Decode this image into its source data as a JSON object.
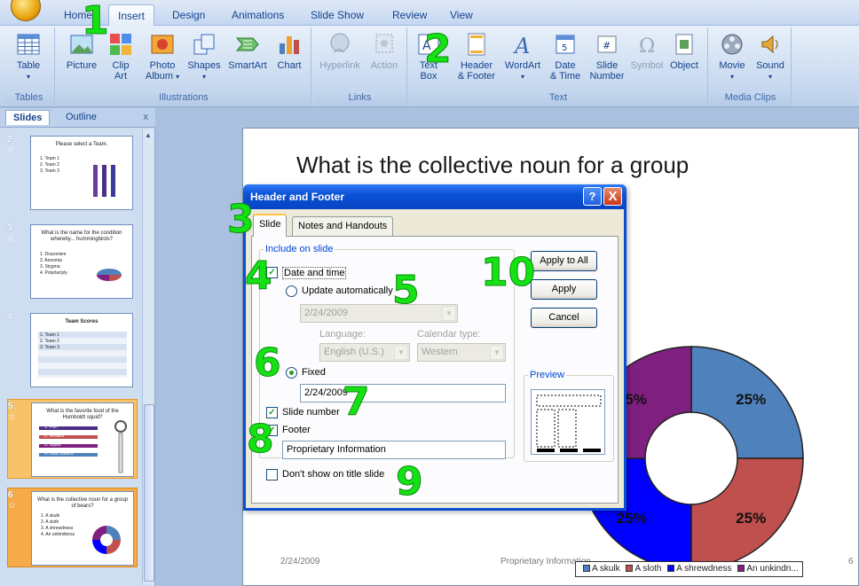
{
  "ribbon": {
    "tabs": [
      "Home",
      "Insert",
      "Design",
      "Animations",
      "Slide Show",
      "Review",
      "View"
    ],
    "active_tab": "Insert",
    "groups": {
      "tables": {
        "label": "Tables",
        "table": "Table"
      },
      "illustrations": {
        "label": "Illustrations",
        "picture": "Picture",
        "clip_art": [
          "Clip",
          "Art"
        ],
        "photo_album": [
          "Photo",
          "Album"
        ],
        "shapes": "Shapes",
        "smartart": "SmartArt",
        "chart": "Chart"
      },
      "links": {
        "label": "Links",
        "hyperlink": "Hyperlink",
        "action": "Action"
      },
      "text": {
        "label": "Text",
        "text_box": [
          "Text",
          "Box"
        ],
        "header_footer": [
          "Header",
          "& Footer"
        ],
        "wordart": "WordArt",
        "date_time": [
          "Date",
          "& Time"
        ],
        "slide_number": [
          "Slide",
          "Number"
        ],
        "symbol": "Symbol",
        "object": "Object"
      },
      "media": {
        "label": "Media Clips",
        "movie": "Movie",
        "sound": "Sound"
      }
    }
  },
  "left_pane": {
    "tabs": [
      "Slides",
      "Outline"
    ],
    "close": "x",
    "thumbnails": [
      {
        "num": "2",
        "title": "Please select a Team.",
        "lines": [
          "1. Team 1",
          "2. Team 2",
          "3. Team 3"
        ]
      },
      {
        "num": "3",
        "title": "What is the name for the condition whereby... hummingbirds?",
        "lines": [
          "1. Draconism",
          "2. Anosmia",
          "3. Stygma",
          "4. Polydactyly"
        ]
      },
      {
        "num": "4",
        "title": "Team Scores",
        "lines": [
          "1. Team 1",
          "2. Team 2",
          "3. Team 3"
        ]
      },
      {
        "num": "5",
        "title": "What is the favorite food of the Humboldt squid?",
        "lines": [
          "1. Fish",
          "2. Whales",
          "3. Squid",
          "4. Leaf Cutters"
        ]
      },
      {
        "num": "6",
        "title": "What is the collective noun for a group of bears?",
        "lines": [
          "1. A skulk",
          "2. A sloth",
          "3. A shrewdness",
          "4. An unkindness"
        ]
      }
    ]
  },
  "slide": {
    "title": "What is the collective noun for a group",
    "date": "2/24/2009",
    "footer": "Proprietary Information",
    "slide_number": "6",
    "legend": [
      "A skulk",
      "A sloth",
      "A shrewdness",
      "An unkindn..."
    ]
  },
  "chart_data": {
    "type": "pie",
    "categories": [
      "A skulk",
      "A sloth",
      "A shrewdness",
      "An unkindn..."
    ],
    "values": [
      25,
      25,
      25,
      25
    ],
    "labels": [
      "25%",
      "25%",
      "25%",
      "25%"
    ],
    "colors": [
      "#4f81bd",
      "#c0504d",
      "#0000ff",
      "#7f1f7f"
    ],
    "title": "",
    "legend": "bottom"
  },
  "dialog": {
    "title": "Header and Footer",
    "help": "?",
    "close": "X",
    "tabs": [
      "Slide",
      "Notes and Handouts"
    ],
    "include_legend": "Include on slide",
    "date_time": "Date and time",
    "update_auto": "Update automatically",
    "auto_date": "2/24/2009",
    "language_label": "Language:",
    "language": "English (U.S.)",
    "calendar_label": "Calendar type:",
    "calendar": "Western",
    "fixed": "Fixed",
    "fixed_date": "2/24/2009",
    "slide_number": "Slide number",
    "footer": "Footer",
    "footer_text": "Proprietary Information",
    "dont_show": "Don't show on title slide",
    "apply_all": "Apply to All",
    "apply": "Apply",
    "cancel": "Cancel",
    "preview": "Preview"
  },
  "steps": [
    "1",
    "2",
    "3",
    "4",
    "5",
    "6",
    "7",
    "8",
    "9",
    "10"
  ]
}
